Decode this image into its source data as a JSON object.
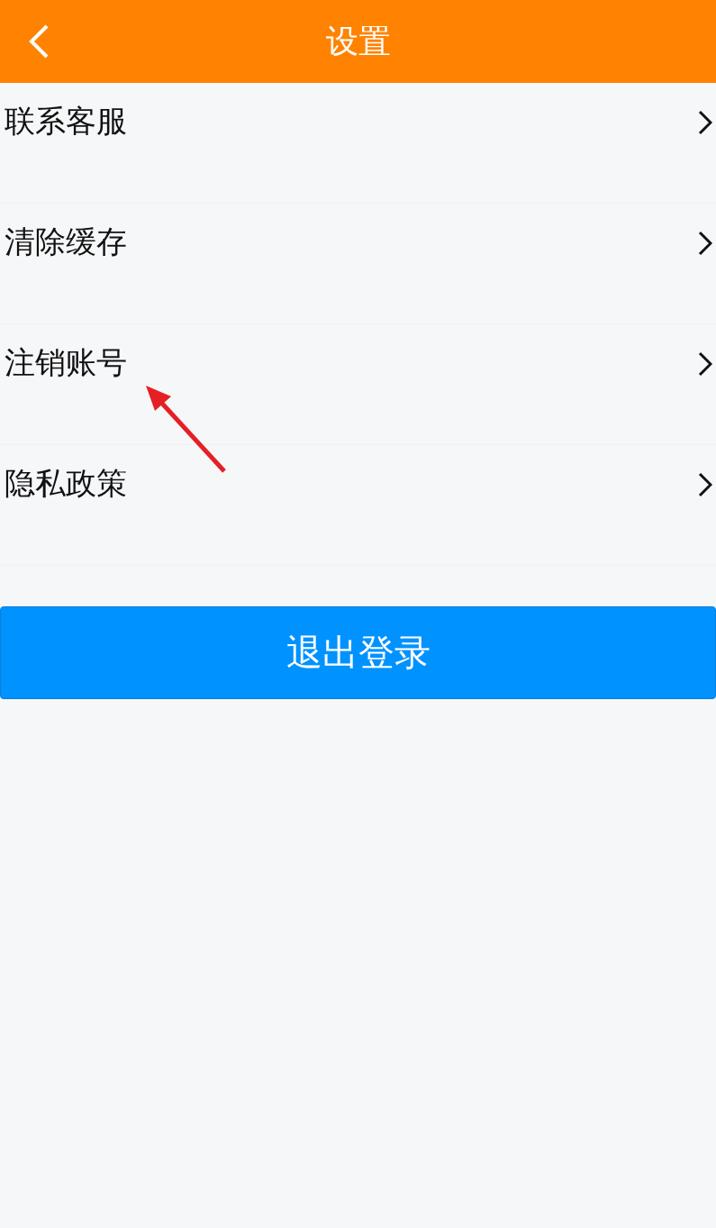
{
  "header": {
    "title": "设置"
  },
  "items": [
    {
      "label": "联系客服"
    },
    {
      "label": "清除缓存"
    },
    {
      "label": "注销账号"
    },
    {
      "label": "隐私政策"
    }
  ],
  "logout_button": {
    "label": "退出登录"
  }
}
